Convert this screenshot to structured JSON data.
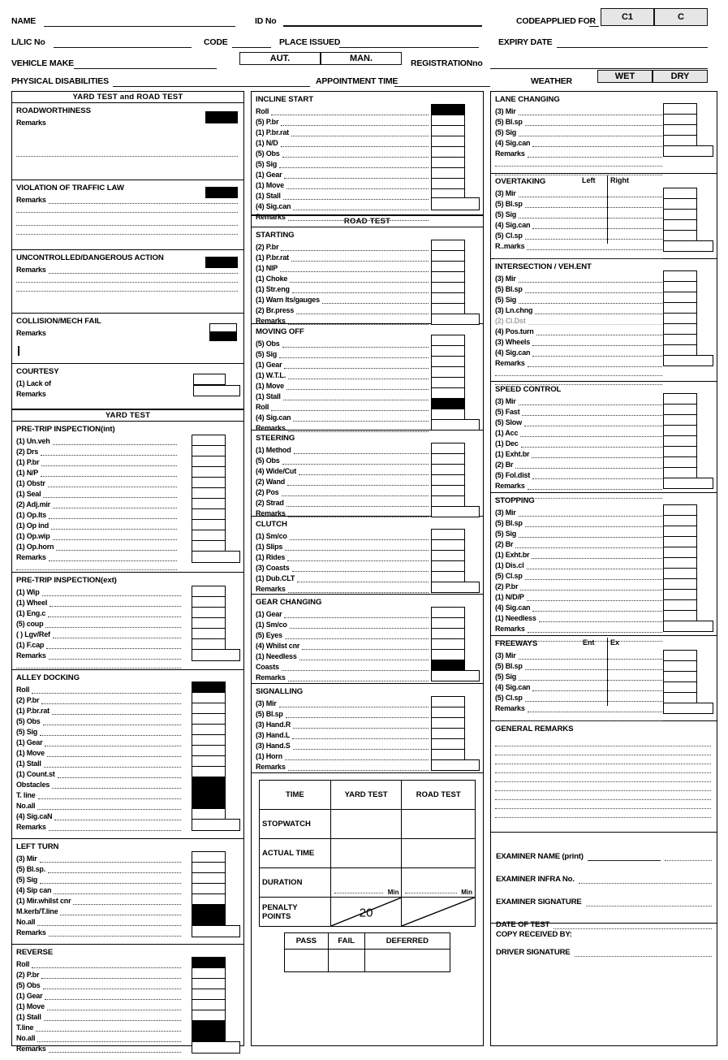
{
  "header": {
    "fields": [
      {
        "label": "NAME",
        "name": "name"
      },
      {
        "label": "ID No",
        "name": "id-no"
      },
      {
        "label": "CODE APPLIED FOR",
        "name": "code-applied-for"
      },
      {
        "label": "L/LIC No",
        "name": "learner-licence-no"
      },
      {
        "label": "CODE",
        "name": "code"
      },
      {
        "label": "PLACE ISSUED",
        "name": "place-issued"
      },
      {
        "label": "EXPIRY DATE",
        "name": "expiry-date"
      },
      {
        "label": "VEHICLE MAKE",
        "name": "vehicle-make"
      },
      {
        "label": "REGISTRATION no",
        "name": "registration-no"
      },
      {
        "label": "PHYSICAL DISABILITIES",
        "name": "physical-disabilities"
      },
      {
        "label": "APPOINTMENT TIME",
        "name": "appointment-time"
      },
      {
        "label": "WEATHER",
        "name": "weather"
      }
    ],
    "name_label": "NAME",
    "id_label": "ID No",
    "code_applied_label": "CODEAPPLIED FOR",
    "code_c1": "C1",
    "code_c": "C",
    "llic_label": "L/LIC No",
    "code_label": "CODE",
    "place_issued_label": "PLACE ISSUED",
    "expiry_date_label": "EXPIRY DATE",
    "vehicle_make_label": "VEHICLE MAKE",
    "aut_label": "AUT.",
    "man_label": "MAN.",
    "registration_label": "REGISTRATIONno",
    "physical_disabilities_label": "PHYSICAL DISABILITIES",
    "appointment_time_label": "APPOINTMENT TIME",
    "weather_label": "WEATHER",
    "wet_label": "WET",
    "dry_label": "DRY"
  },
  "banners": {
    "yard_and_road": "YARD TEST and ROAD TEST",
    "yard_test": "YARD TEST",
    "road_test": "ROAD TEST"
  },
  "left": {
    "roadworthiness": {
      "title": "ROADWORTHINESS",
      "remarks": "Remarks"
    },
    "violation": {
      "title": "VIOLATION OF TRAFFIC LAW",
      "remarks": "Remarks"
    },
    "uncontrolled": {
      "title": "UNCONTROLLED/DANGEROUS ACTION",
      "remarks": "Remarks"
    },
    "collision": {
      "title": "COLLISION/MECH  FAIL",
      "remarks": "Remarks"
    },
    "courtesy": {
      "title": "COURTESY",
      "lack": "(1) Lack of",
      "remarks": "Remarks"
    },
    "pretrip_int": {
      "title": "PRE-TRIP INSPECTION(int)",
      "items": [
        "(1) Un.veh",
        "(2) Drs",
        "(1) P.br",
        "(1) N/P",
        "(1) Obstr",
        "(1) Seal",
        "(2) Adj.mir",
        "(1) Op.lts",
        "(1) Op ind",
        "(1) Op.wip",
        "(1) Op.horn"
      ],
      "remarks": "Remarks"
    },
    "pretrip_ext": {
      "title": "PRE-TRIP INSPECTION(ext)",
      "items": [
        "(1) Wip",
        "(1) Wheel",
        "(1) Eng.c",
        "(5) coup",
        "(  ) Lgv/Ref",
        "(1) F.cap"
      ],
      "remarks": "Remarks"
    },
    "alley_docking": {
      "title": "ALLEY DOCKING",
      "items": [
        "Roll",
        "(2) P.br",
        "(1) P.br.rat",
        "(5) Obs",
        "(5) Sig",
        "(1) Gear",
        "(1) Move",
        "(1) Stall",
        "(1) Count.st",
        "Obstacles",
        "T. line",
        "No.all",
        "(4) Sig.caN"
      ],
      "remarks": "Remarks",
      "black_rows": [
        0,
        9,
        10,
        11
      ]
    },
    "left_turn": {
      "title": "LEFT TURN",
      "items": [
        "(3) Mir",
        "(5) Bl.sp.",
        "(5) Sig",
        "(4) Sip can",
        "(1) Mir.whilst cnr",
        "M.kerb/T.line",
        "No.all"
      ],
      "remarks": "Remarks",
      "black_rows": [
        5,
        6
      ]
    },
    "reverse": {
      "title": "REVERSE",
      "items": [
        "Roll",
        "(2) P.br",
        "(5) Obs",
        "(1) Gear",
        "(1) Move",
        "(1) Stall",
        "T.line",
        "No.all"
      ],
      "remarks": "Remarks",
      "black_rows": [
        0,
        6,
        7
      ]
    }
  },
  "middle": {
    "incline_start": {
      "title": "INCLINE START",
      "items": [
        "Roll",
        "(5) P.br",
        "(1) P.br.rat",
        "(1) N/D",
        "(5) Obs",
        "(5) Sig",
        "(1) Gear",
        "(1) Move",
        "(1) Stall",
        "(4) Sig.can"
      ],
      "remarks": "Remarks",
      "black_rows": [
        0
      ]
    },
    "starting": {
      "title": "STARTING",
      "items": [
        "(2) P.br",
        "(1) P.br.rat",
        "(1) NlP",
        "(1) Choke",
        "(1) Str.eng",
        "(1) Warn lts/gauges",
        "(2) Br.press"
      ],
      "remarks": "Remarks",
      "black_rows": []
    },
    "moving_off": {
      "title": "MOVING OFF",
      "items": [
        "(5) Obs",
        "(5) Sig",
        "(1) Gear",
        "(1) W.T.L.",
        "(1) Move",
        "(1) Stall",
        "Roll",
        "(4) Sig.can"
      ],
      "remarks": "Remarks",
      "black_rows": [
        6
      ]
    },
    "steering": {
      "title": "STEERING",
      "items": [
        "(1) Method",
        "(5) Obs",
        "(4) Wide/Cut",
        "(2) Wand",
        "(2) Pos",
        "(2) Strad"
      ],
      "remarks": "Remarks",
      "black_rows": []
    },
    "clutch": {
      "title": "CLUTCH",
      "items": [
        "(1) Sm/co",
        "(1) Slips",
        "(1) Rides",
        "(3) Coasts",
        "(1) Dub.CLT"
      ],
      "remarks": "Remarks",
      "black_rows": []
    },
    "gear_changing": {
      "title": "GEAR CHANGING",
      "items": [
        "(1) Gear",
        "(1) Sm/co",
        "(5) Eyes",
        "(4) Whilst cnr",
        "(1) Needless",
        "Coasts"
      ],
      "remarks": "Remarks",
      "black_rows": [
        5
      ]
    },
    "signalling": {
      "title": "SIGNALLING",
      "items": [
        "(3) Mir",
        "(5) Bl.sp",
        "(3) Hand.R",
        "(3) Hand.L",
        "(3) Hand.S",
        "(1) Horn"
      ],
      "remarks": "Remarks",
      "black_rows": []
    },
    "time_table": {
      "columns": [
        "TIME",
        "YARD TEST",
        "ROAD TEST"
      ],
      "rows": [
        "STOPWATCH",
        "ACTUAL TIME",
        "DURATION",
        "PENALTY POINTS"
      ],
      "min_label": "Min",
      "penalty_value": "20"
    },
    "result_table": {
      "columns": [
        "PASS",
        "FAIL",
        "DEFERRED"
      ]
    }
  },
  "right": {
    "lane_changing": {
      "title": "LANE CHANGING",
      "items": [
        "(3) Mir",
        "(5) Bl.sp",
        "(5) Sig",
        "(4) Sig.can"
      ],
      "remarks": "Remarks",
      "black_rows": []
    },
    "overtaking": {
      "title": "OVERTAKING",
      "col_left": "Left",
      "col_right": "Right",
      "items": [
        "(3) Mir",
        "(5) Bl.sp",
        "(5) Sig",
        "(4) Sig.can",
        "(5) Cl.sp"
      ],
      "remarks": "R..marks",
      "black_rows": []
    },
    "intersection": {
      "title": "INTERSECTION / VEH.ENT",
      "items": [
        "(3) Mir",
        "(5) Bl.sp",
        "(5) Sig",
        "(3) Ln.chng",
        "(2) Cl.Dst",
        "(4) Pos.turn",
        "(3) Wheels",
        "(4) Sig.can"
      ],
      "remarks": "Remarks",
      "black_rows": []
    },
    "speed_control": {
      "title": "SPEED CONTROL",
      "items": [
        "(3) Mir",
        "(5) Fast",
        "(5) Slow",
        "(1) Acc",
        "(1) Dec",
        "(1) Exht.br",
        "(2) Br",
        "(5) Fol.dist"
      ],
      "remarks": "Remarks",
      "black_rows": []
    },
    "stopping": {
      "title": "STOPPING",
      "items": [
        "(3) Mir",
        "(5) Bl.sp",
        "(5) Sig",
        "(2) Br",
        "(1) Exht.br",
        "(1) Dis.cl",
        "(5) Cl.sp",
        "(2) P.br",
        "(1) N/D/P",
        "(4) Sig.can",
        "(1) Needless"
      ],
      "remarks": "Remarks",
      "black_rows": []
    },
    "freeways": {
      "title": "FREEWAYS",
      "col_left": "Ent",
      "col_right": "Ex",
      "items": [
        "(3) Mir",
        "(5) Bl.sp",
        "(5) Sig",
        "(4) Sig.can",
        "(5) Cl.sp"
      ],
      "remarks": "Remarks",
      "black_rows": []
    },
    "general_remarks": {
      "title": "GENERAL REMARKS"
    },
    "signoff": {
      "examiner_name": "EXAMINER NAME (print)",
      "examiner_infra": "EXAMINER  INFRA No.",
      "examiner_signature": "EXAMINER SIGNATURE",
      "date_of_test": "DATE OF TEST",
      "copy_received": "COPY RECEIVED BY:",
      "driver_signature": "DRIVER SIGNATURE"
    }
  }
}
